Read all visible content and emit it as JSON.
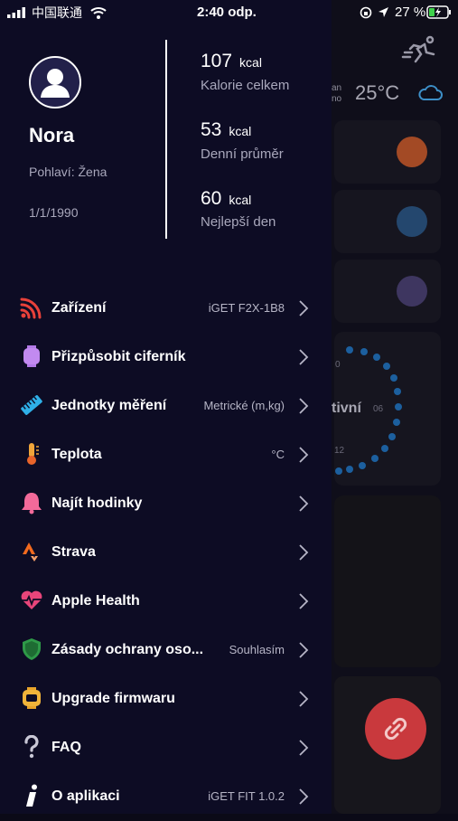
{
  "status_bar": {
    "carrier": "中国联通",
    "time": "2:40 odp.",
    "battery": "27 %"
  },
  "profile": {
    "name": "Nora",
    "gender": "Pohlaví: Žena",
    "birthdate": "1/1/1990"
  },
  "stats": [
    {
      "value": "107",
      "unit": "kcal",
      "label": "Kalorie celkem"
    },
    {
      "value": "53",
      "unit": "kcal",
      "label": "Denní průměr"
    },
    {
      "value": "60",
      "unit": "kcal",
      "label": "Nejlepší den"
    }
  ],
  "menu": [
    {
      "label": "Zařízení",
      "value": "iGET F2X-1B8",
      "icon": "device-signal-icon"
    },
    {
      "label": "Přizpůsobit ciferník",
      "value": "",
      "icon": "watch-face-icon"
    },
    {
      "label": "Jednotky měření",
      "value": "Metrické (m,kg)",
      "icon": "ruler-icon"
    },
    {
      "label": "Teplota",
      "value": "°C",
      "icon": "thermometer-icon"
    },
    {
      "label": "Najít hodinky",
      "value": "",
      "icon": "bell-icon"
    },
    {
      "label": "Strava",
      "value": "",
      "icon": "strava-icon"
    },
    {
      "label": "Apple Health",
      "value": "",
      "icon": "heart-pulse-icon"
    },
    {
      "label": "Zásady ochrany oso...",
      "value": "Souhlasím",
      "icon": "shield-check-icon"
    },
    {
      "label": "Upgrade firmwaru",
      "value": "",
      "icon": "firmware-icon"
    },
    {
      "label": "FAQ",
      "value": "",
      "icon": "question-icon"
    },
    {
      "label": "O aplikaci",
      "value": "iGET FIT 1.0.2",
      "icon": "info-icon"
    }
  ],
  "background": {
    "weather_temp": "25°C",
    "weather_partial": "an\nno",
    "activity_partial": "tivní",
    "dial_labels": [
      "0",
      "06",
      "12"
    ]
  },
  "colors": {
    "drawer_bg": "#0d0c24",
    "accent_blue": "#1c7fd6",
    "fab_red": "#c9393d"
  }
}
